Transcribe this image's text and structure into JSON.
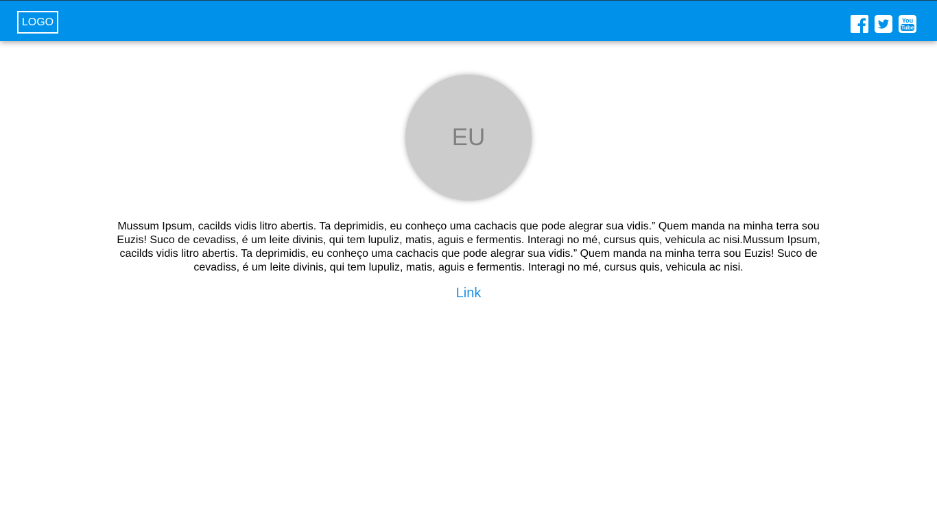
{
  "header": {
    "logo_text": "LOGO",
    "bg_color": "#0091ea",
    "social": [
      {
        "icon": "facebook-icon"
      },
      {
        "icon": "twitter-icon"
      },
      {
        "icon": "youtube-icon",
        "text_top": "You",
        "text_bottom": "Tube"
      }
    ]
  },
  "profile": {
    "avatar_text": "EU",
    "bio": "Mussum Ipsum, cacilds vidis litro abertis. Ta deprimidis, eu conheço uma cachacis que pode alegrar sua vidis.” Quem manda na minha terra sou Euzis! Suco de cevadiss, é um leite divinis, qui tem lupuliz, matis, aguis e fermentis. Interagi no mé, cursus quis, vehicula ac nisi.Mussum Ipsum, cacilds vidis litro abertis. Ta deprimidis, eu conheço uma cachacis que pode alegrar sua vidis.” Quem manda na minha terra sou Euzis! Suco de cevadiss, é um leite divinis, qui tem lupuliz, matis, aguis e fermentis. Interagi no mé, cursus quis, vehicula ac nisi.",
    "link_label": "Link",
    "link_color": "#1e90e8"
  }
}
